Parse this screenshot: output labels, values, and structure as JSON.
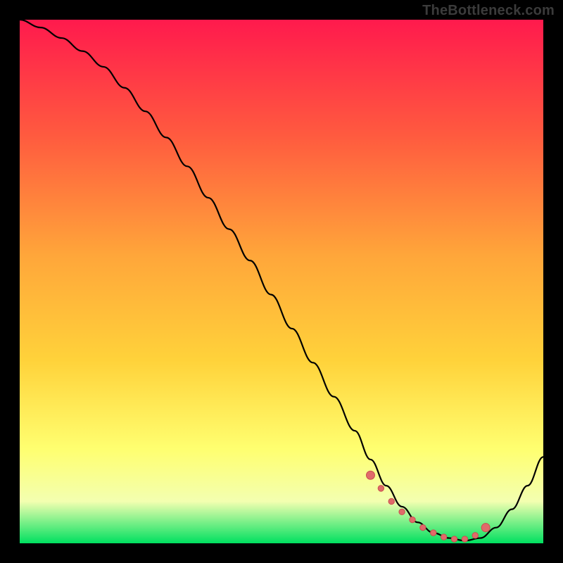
{
  "watermark": "TheBottleneck.com",
  "colors": {
    "bg": "#000000",
    "grad_top": "#ff1a4d",
    "grad_mid_upper": "#ff7a3a",
    "grad_mid": "#ffd23a",
    "grad_mid_lower": "#ffff66",
    "grad_lower": "#f7ffb0",
    "grad_bottom": "#00e060",
    "curve": "#000000",
    "marker_fill": "#e06a6a",
    "marker_stroke": "#c94f4f"
  },
  "chart_data": {
    "type": "line",
    "title": "",
    "xlabel": "",
    "ylabel": "",
    "xlim": [
      0,
      100
    ],
    "ylim": [
      0,
      100
    ],
    "grid": false,
    "legend": null,
    "annotations": [],
    "series": [
      {
        "name": "curve",
        "x": [
          0,
          4,
          8,
          12,
          16,
          20,
          24,
          28,
          32,
          36,
          40,
          44,
          48,
          52,
          56,
          60,
          64,
          67,
          70,
          73,
          76,
          79,
          82,
          85,
          88,
          91,
          94,
          97,
          100
        ],
        "y": [
          100,
          98.5,
          96.5,
          94,
          91,
          87,
          82.5,
          77.5,
          72,
          66,
          60,
          54,
          47.5,
          41,
          34.5,
          28,
          21.5,
          16,
          11,
          7,
          4,
          2,
          1,
          0.5,
          1,
          3,
          6.5,
          11,
          16.5
        ]
      }
    ],
    "markers": {
      "name": "highlight-region",
      "x": [
        67,
        69,
        71,
        73,
        75,
        77,
        79,
        81,
        83,
        85,
        87,
        89
      ],
      "y": [
        13,
        10.5,
        8,
        6,
        4.5,
        3,
        2,
        1.2,
        0.8,
        0.8,
        1.5,
        3
      ]
    }
  }
}
